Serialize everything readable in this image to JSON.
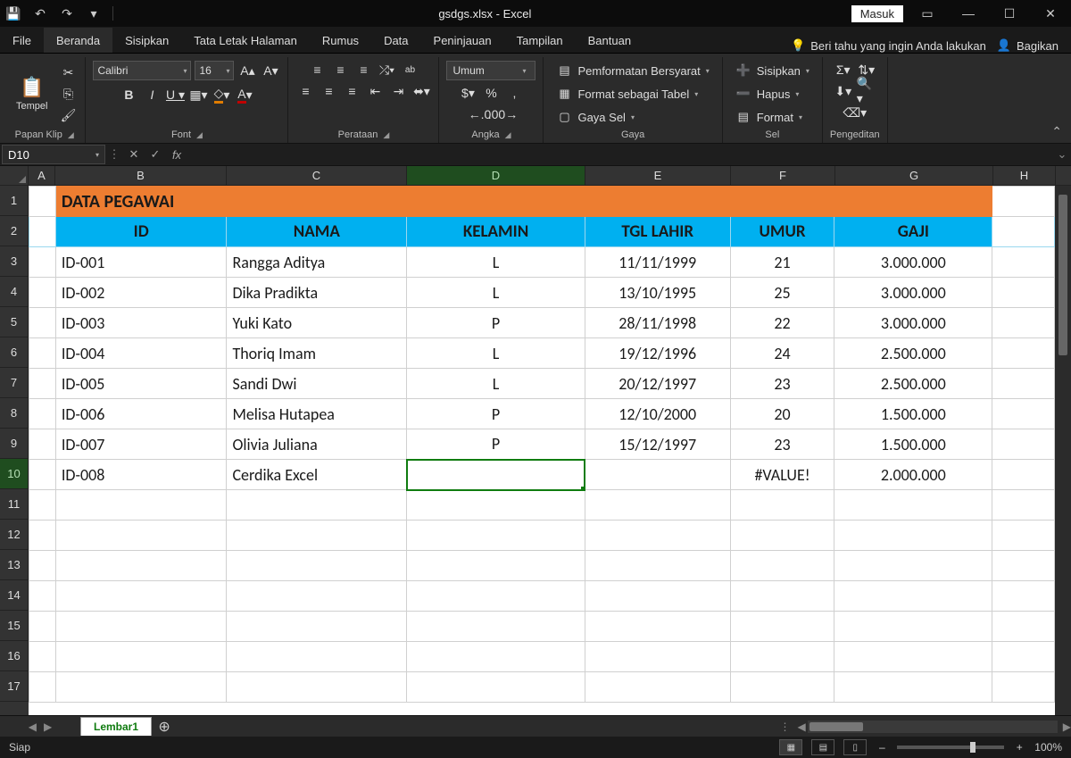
{
  "titlebar": {
    "filename": "gsdgs.xlsx  -  Excel",
    "masuk": "Masuk"
  },
  "tabs": {
    "file": "File",
    "beranda": "Beranda",
    "sisipkan": "Sisipkan",
    "tataletak": "Tata Letak Halaman",
    "rumus": "Rumus",
    "data": "Data",
    "peninjauan": "Peninjauan",
    "tampilan": "Tampilan",
    "bantuan": "Bantuan",
    "tellme": "Beri tahu yang ingin Anda lakukan",
    "bagikan": "Bagikan"
  },
  "ribbon": {
    "clipboard": {
      "tempel": "Tempel",
      "label": "Papan Klip"
    },
    "font": {
      "name": "Calibri",
      "size": "16",
      "label": "Font"
    },
    "align": {
      "label": "Perataan",
      "wrap": "ab"
    },
    "number": {
      "format": "Umum",
      "label": "Angka"
    },
    "styles": {
      "cond": "Pemformatan Bersyarat",
      "table": "Format sebagai Tabel",
      "cell": "Gaya Sel",
      "label": "Gaya"
    },
    "cells": {
      "insert": "Sisipkan",
      "delete": "Hapus",
      "format": "Format",
      "label": "Sel"
    },
    "editing": {
      "label": "Pengeditan"
    }
  },
  "formula": {
    "cell": "D10",
    "value": ""
  },
  "columns": [
    "A",
    "B",
    "C",
    "D",
    "E",
    "F",
    "G",
    "H"
  ],
  "sheet": {
    "name": "Lembar1"
  },
  "status": {
    "ready": "Siap",
    "zoom": "100%"
  },
  "data": {
    "title": "DATA PEGAWAI",
    "headers": {
      "id": "ID",
      "nama": "NAMA",
      "kelamin": "KELAMIN",
      "tgl": "TGL LAHIR",
      "umur": "UMUR",
      "gaji": "GAJI"
    },
    "rows": [
      {
        "id": "ID-001",
        "nama": "Rangga Aditya",
        "kelamin": "L",
        "tgl": "11/11/1999",
        "umur": "21",
        "gaji": "3.000.000"
      },
      {
        "id": "ID-002",
        "nama": "Dika Pradikta",
        "kelamin": "L",
        "tgl": "13/10/1995",
        "umur": "25",
        "gaji": "3.000.000"
      },
      {
        "id": "ID-003",
        "nama": "Yuki Kato",
        "kelamin": "P",
        "tgl": "28/11/1998",
        "umur": "22",
        "gaji": "3.000.000"
      },
      {
        "id": "ID-004",
        "nama": "Thoriq Imam",
        "kelamin": "L",
        "tgl": "19/12/1996",
        "umur": "24",
        "gaji": "2.500.000"
      },
      {
        "id": "ID-005",
        "nama": "Sandi Dwi",
        "kelamin": "L",
        "tgl": "20/12/1997",
        "umur": "23",
        "gaji": "2.500.000"
      },
      {
        "id": "ID-006",
        "nama": "Melisa Hutapea",
        "kelamin": "P",
        "tgl": "12/10/2000",
        "umur": "20",
        "gaji": "1.500.000"
      },
      {
        "id": "ID-007",
        "nama": "Olivia Juliana",
        "kelamin": "P",
        "tgl": "15/12/1997",
        "umur": "23",
        "gaji": "1.500.000"
      },
      {
        "id": "ID-008",
        "nama": "Cerdika Excel",
        "kelamin": "",
        "tgl": "",
        "umur": "#VALUE!",
        "gaji": "2.000.000"
      }
    ]
  }
}
